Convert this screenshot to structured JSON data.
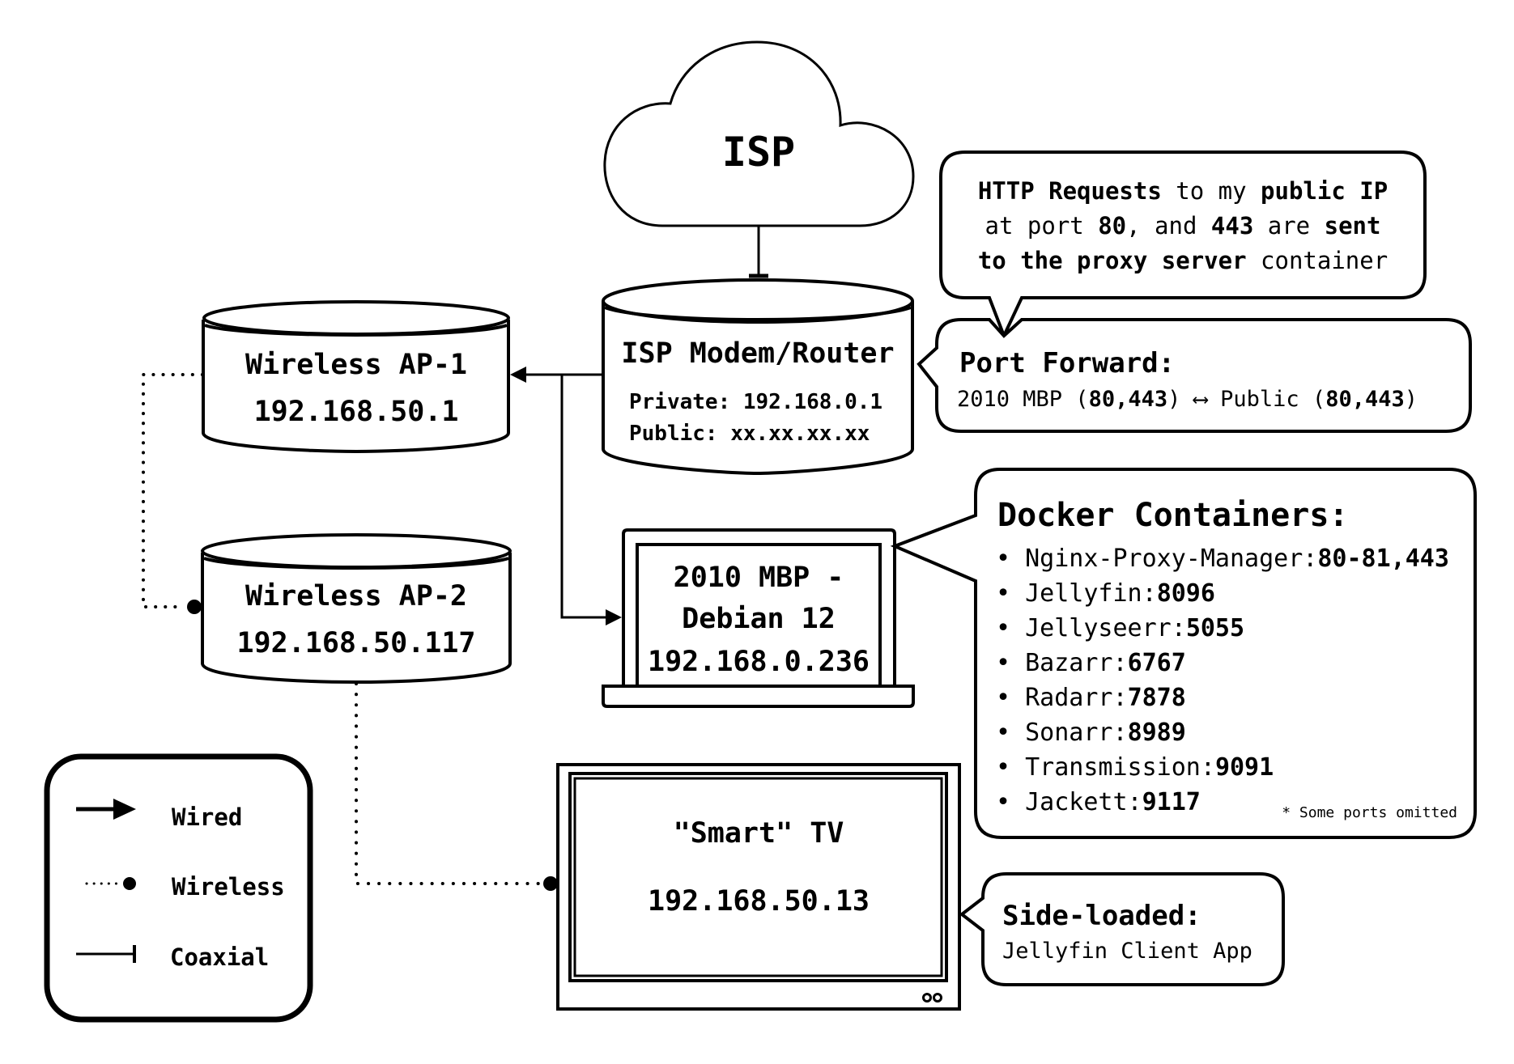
{
  "colors": {
    "stroke": "#000000",
    "background": "#ffffff"
  },
  "isp": {
    "label": "ISP",
    "icon": "cloud-icon"
  },
  "router": {
    "title": "ISP Modem/Router",
    "private": "Private: 192.168.0.1",
    "public": "Public: xx.xx.xx.xx",
    "icon": "cylinder-icon"
  },
  "ap1": {
    "name": "Wireless AP-1",
    "ip": "192.168.50.1",
    "icon": "cylinder-icon"
  },
  "ap2": {
    "name": "Wireless AP-2",
    "ip": "192.168.50.117",
    "icon": "cylinder-icon"
  },
  "mbp": {
    "line1": "2010 MBP -",
    "line2": "Debian 12",
    "ip": "192.168.0.236",
    "icon": "laptop-icon"
  },
  "tv": {
    "name": "\"Smart\" TV",
    "ip": "192.168.50.13",
    "icon": "tv-icon"
  },
  "http_note": {
    "line1": [
      {
        "t": "HTTP Requests",
        "b": true
      },
      {
        "t": " to my ",
        "b": false
      },
      {
        "t": "public IP",
        "b": true
      }
    ],
    "line2": [
      {
        "t": "at port ",
        "b": false
      },
      {
        "t": "80",
        "b": true
      },
      {
        "t": ", and ",
        "b": false
      },
      {
        "t": "443",
        "b": true
      },
      {
        "t": " are ",
        "b": false
      },
      {
        "t": "sent",
        "b": true
      }
    ],
    "line3": [
      {
        "t": "to the proxy server",
        "b": true
      },
      {
        "t": " container",
        "b": false
      }
    ]
  },
  "port_forward": {
    "title": "Port Forward:",
    "rule": [
      {
        "t": "2010 MBP (",
        "b": false
      },
      {
        "t": "80,443",
        "b": true
      },
      {
        "t": ") ⟷ Public (",
        "b": false
      },
      {
        "t": "80,443",
        "b": true
      },
      {
        "t": ")",
        "b": false
      }
    ]
  },
  "docker": {
    "title": "Docker Containers:",
    "containers": [
      {
        "name": "Nginx-Proxy-Manager:",
        "ports": "80-81,443"
      },
      {
        "name": "Jellyfin:",
        "ports": "8096"
      },
      {
        "name": "Jellyseerr:",
        "ports": "5055"
      },
      {
        "name": "Bazarr:",
        "ports": "6767"
      },
      {
        "name": "Radarr:",
        "ports": "7878"
      },
      {
        "name": "Sonarr:",
        "ports": "8989"
      },
      {
        "name": "Transmission:",
        "ports": "9091"
      },
      {
        "name": "Jackett:",
        "ports": "9117"
      }
    ],
    "footnote": "* Some ports omitted"
  },
  "sideloaded": {
    "title": "Side-loaded:",
    "app": "Jellyfin Client App"
  },
  "legend": {
    "items": [
      {
        "label": "Wired",
        "icon": "arrow-icon"
      },
      {
        "label": "Wireless",
        "icon": "dotted-dot-icon"
      },
      {
        "label": "Coaxial",
        "icon": "tee-end-icon"
      }
    ]
  }
}
